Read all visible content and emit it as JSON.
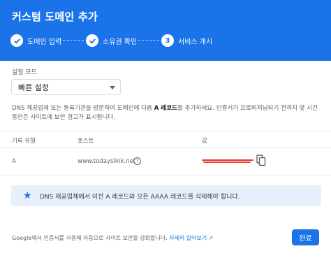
{
  "dialog": {
    "title": "커스텀 도메인 추가"
  },
  "steps": [
    {
      "label": "도메인 입력",
      "state": "done",
      "icon": "check-icon"
    },
    {
      "label": "소유권 확인",
      "state": "done",
      "icon": "check-icon"
    },
    {
      "label": "서비스 개시",
      "state": "current",
      "number": "3"
    }
  ],
  "mode": {
    "label": "설정 모드",
    "selected": "빠른 설정"
  },
  "description": {
    "before": "DNS 제공업체 또는 등록기관을 방문하여 도메인에 다음 ",
    "bold": "A 레코드",
    "after": "를 추가하세요. 인증서가 프로비저닝되기 전까지 몇 시간 동안은 사이트에 보안 경고가 표시됩니다."
  },
  "table": {
    "headers": {
      "record_type": "기록 유형",
      "host": "호스트",
      "value": "값"
    },
    "rows": [
      {
        "record_type": "A",
        "host": "www.todayslink.net"
      }
    ]
  },
  "banner": {
    "icon": "star-icon",
    "text": "DNS 제공업체에서 이전 A 레코드와 모든 AAAA 레코드를 삭제해야 합니다."
  },
  "footer": {
    "text": "Google에서 인증서를 사용해 자동으로 사이트 보안을 강화합니다.",
    "link": "자세히 알아보기"
  },
  "actions": {
    "done": "완료"
  },
  "colors": {
    "primary": "#1a73e8",
    "banner_bg": "#e8f0fe",
    "redaction": "#e53935"
  }
}
